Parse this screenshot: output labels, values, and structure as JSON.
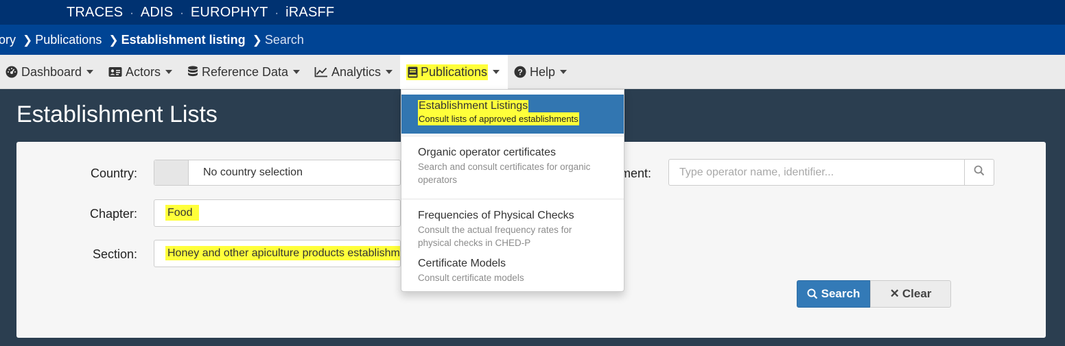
{
  "topbar": {
    "apps": [
      "TRACES",
      "ADIS",
      "EUROPHYT",
      "iRASFF"
    ],
    "separator": "·"
  },
  "breadcrumb": {
    "first": "ory",
    "items": [
      "Publications",
      "Establishment listing",
      "Search"
    ]
  },
  "navbar": {
    "items": [
      {
        "label": "Dashboard",
        "icon": "dashboard-icon"
      },
      {
        "label": "Actors",
        "icon": "id-card-icon"
      },
      {
        "label": "Reference Data",
        "icon": "database-icon"
      },
      {
        "label": "Analytics",
        "icon": "line-chart-icon"
      },
      {
        "label": "Publications",
        "icon": "book-icon"
      },
      {
        "label": "Help",
        "icon": "question-circle-icon"
      }
    ]
  },
  "page": {
    "title": "Establishment Lists"
  },
  "form": {
    "country_label": "Country:",
    "country_value": "No country selection",
    "chapter_label": "Chapter:",
    "chapter_value": "Food",
    "section_label": "Section:",
    "section_value": "Honey and other apiculture products establishm",
    "establishment_label_partial": "ment:",
    "establishment_placeholder": "Type operator name, identifier..."
  },
  "buttons": {
    "search": "Search",
    "clear": "Clear"
  },
  "dropdown": {
    "items": [
      {
        "title": "Establishment Listings",
        "desc": "Consult lists of approved establishments"
      },
      {
        "title": "Organic operator certificates",
        "desc_1": "Search and consult certificates for organic",
        "desc_2": "operators"
      },
      {
        "title": "Frequencies of Physical Checks",
        "desc_1": "Consult the actual frequency rates for",
        "desc_2": "physical checks in CHED-P"
      },
      {
        "title": "Certificate Models",
        "desc": "Consult certificate models"
      }
    ]
  },
  "colors": {
    "top_bar": "#003271",
    "breadcrumb_bar": "#004494",
    "page_bg": "#2b3e50",
    "primary": "#337ab7",
    "highlight": "#ffff3a"
  }
}
